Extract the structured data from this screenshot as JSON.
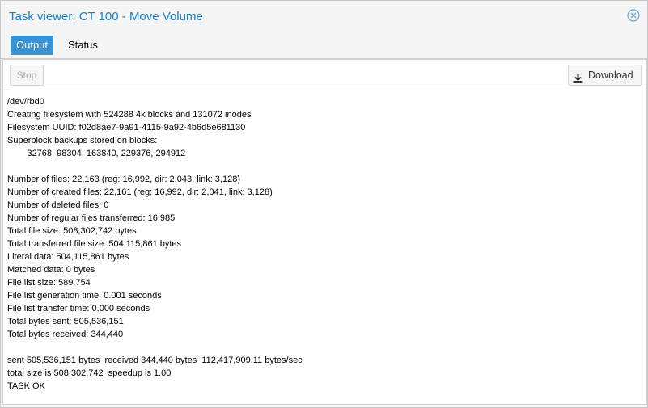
{
  "window": {
    "title": "Task viewer: CT 100 - Move Volume",
    "close_icon": "close-circle-icon"
  },
  "tabs": [
    {
      "label": "Output",
      "active": true
    },
    {
      "label": "Status",
      "active": false
    }
  ],
  "toolbar": {
    "stop_label": "Stop",
    "download_label": "Download",
    "download_icon": "download-icon"
  },
  "log_lines": [
    "/dev/rbd0",
    "Creating filesystem with 524288 4k blocks and 131072 inodes",
    "Filesystem UUID: f02d8ae7-9a91-4115-9a92-4b6d5e681130",
    "Superblock backups stored on blocks:",
    "        32768, 98304, 163840, 229376, 294912",
    "",
    "Number of files: 22,163 (reg: 16,992, dir: 2,043, link: 3,128)",
    "Number of created files: 22,161 (reg: 16,992, dir: 2,041, link: 3,128)",
    "Number of deleted files: 0",
    "Number of regular files transferred: 16,985",
    "Total file size: 508,302,742 bytes",
    "Total transferred file size: 504,115,861 bytes",
    "Literal data: 504,115,861 bytes",
    "Matched data: 0 bytes",
    "File list size: 589,754",
    "File list generation time: 0.001 seconds",
    "File list transfer time: 0.000 seconds",
    "Total bytes sent: 505,536,151",
    "Total bytes received: 344,440",
    "",
    "sent 505,536,151 bytes  received 344,440 bytes  112,417,909.11 bytes/sec",
    "total size is 508,302,742  speedup is 1.00",
    "TASK OK"
  ],
  "colors": {
    "accent": "#157fcc",
    "active_tab": "#3892d4"
  }
}
